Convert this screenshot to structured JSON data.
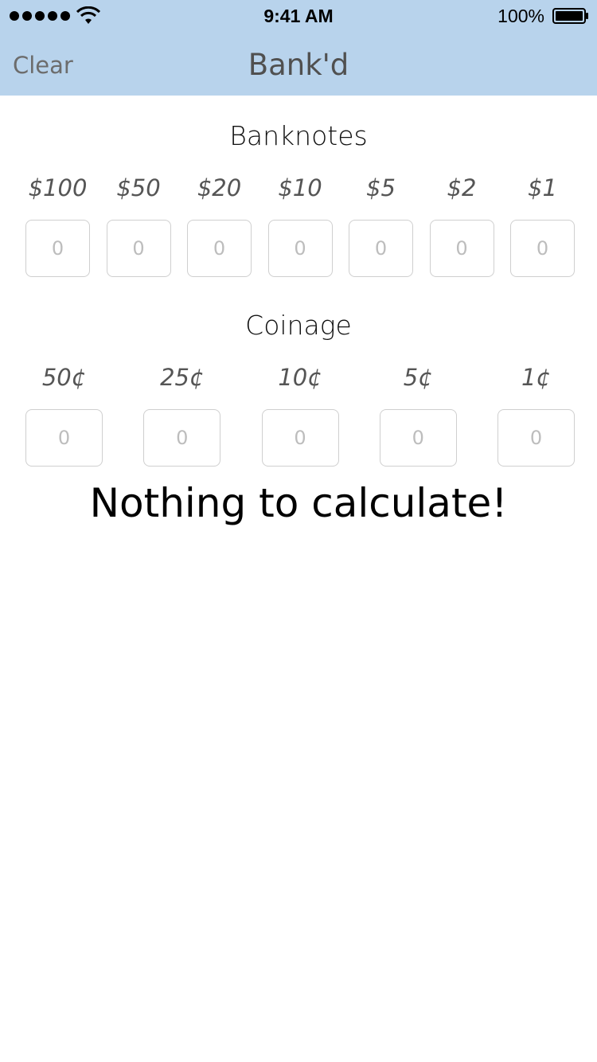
{
  "status_bar": {
    "time": "9:41 AM",
    "battery_percent": "100%",
    "icons": [
      "signal-dots-icon",
      "wifi-icon",
      "battery-icon"
    ]
  },
  "nav": {
    "left_button": "Clear",
    "title": "Bank'd",
    "background_color": "#b8d3ec"
  },
  "banknotes": {
    "title": "Banknotes",
    "denominations": [
      "$100",
      "$50",
      "$20",
      "$10",
      "$5",
      "$2",
      "$1"
    ],
    "placeholders": [
      "0",
      "0",
      "0",
      "0",
      "0",
      "0",
      "0"
    ]
  },
  "coinage": {
    "title": "Coinage",
    "denominations": [
      "50¢",
      "25¢",
      "10¢",
      "5¢",
      "1¢"
    ],
    "placeholders": [
      "0",
      "0",
      "0",
      "0",
      "0"
    ]
  },
  "result_text": "Nothing to calculate!"
}
